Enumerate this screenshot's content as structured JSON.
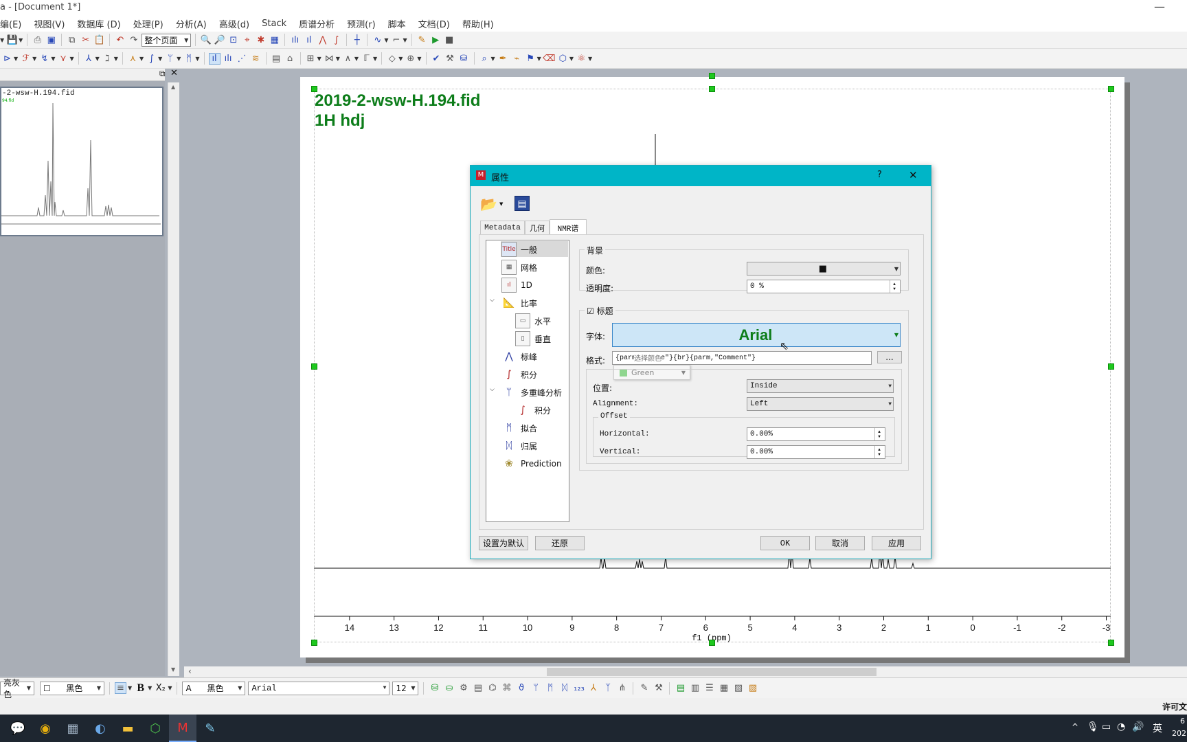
{
  "window": {
    "title": "a - [Document 1*]"
  },
  "menu": [
    "编(E)",
    "视图(V)",
    "数据库 (D)",
    "处理(P)",
    "分析(A)",
    "高级(d)",
    "Stack",
    "质谱分析",
    "预测(r)",
    "脚本",
    "文档(D)",
    "帮助(H)"
  ],
  "toolbar": {
    "page_select": "整个页面"
  },
  "left_panel": {
    "thumb_title": "-2-wsw-H.194.fid",
    "thumb_sub": "94.fid"
  },
  "document": {
    "title_line1": "2019-2-wsw-H.194.fid",
    "title_line2": "1H hdj",
    "axis_label": "f1 (ppm)"
  },
  "chart_data": {
    "type": "line",
    "xlabel": "f1 (ppm)",
    "xlim": [
      14.8,
      -3.1
    ],
    "x_reversed": true,
    "ticks": [
      14,
      13,
      12,
      11,
      10,
      9,
      8,
      7,
      6,
      5,
      4,
      3,
      2,
      1,
      0,
      -1,
      -2,
      -3
    ],
    "tick_labels": [
      "14",
      "13",
      "12",
      "11",
      "10",
      "9",
      "8",
      "7",
      "6",
      "5",
      "4",
      "3",
      "2",
      "1",
      "0",
      "-1",
      "-2",
      "-3"
    ]
  },
  "dialog": {
    "title": "属性",
    "help": "?",
    "close": "✕",
    "tabs": [
      "Metadata",
      "几何",
      "NMR谱"
    ],
    "tree": [
      {
        "label": "一般",
        "selected": true
      },
      {
        "label": "网格"
      },
      {
        "label": "1D"
      },
      {
        "label": "比率",
        "expanded": true
      },
      {
        "label": "水平"
      },
      {
        "label": "垂直"
      },
      {
        "label": "标峰"
      },
      {
        "label": "积分"
      },
      {
        "label": "多重峰分析",
        "expanded": true
      },
      {
        "label": "积分"
      },
      {
        "label": "拟合"
      },
      {
        "label": "归属"
      },
      {
        "label": "Prediction"
      }
    ],
    "background_group": "背景",
    "color_label": "颜色:",
    "color_value": "■",
    "opacity_label": "透明度:",
    "opacity_value": "0 %",
    "title_group": "标题",
    "title_checked": "☑",
    "font_label": "字体:",
    "font_value": "Arial",
    "format_label": "格式:",
    "format_value": "{parm,\"Title\"}{br}{parm,\"Comment\"}",
    "format_overlay": "选择颜色",
    "browse": "...",
    "color_popup": "Green",
    "position_label": "位置:",
    "position_value": "Inside",
    "alignment_label": "Alignment:",
    "alignment_value": "Left",
    "offset_group": "Offset",
    "horizontal_label": "Horizontal:",
    "horizontal_value": "0.00%",
    "vertical_label": "Vertical:",
    "vertical_value": "0.00%",
    "btn_default": "设置为默认",
    "btn_restore": "还原",
    "btn_ok": "OK",
    "btn_cancel": "取消",
    "btn_apply": "应用"
  },
  "bottom_toolbar": {
    "bg_color": "亮灰色",
    "border_color": "黑色",
    "bold": "B",
    "subscript": "X₂",
    "font_color_glyph": "A",
    "font_color": "黑色",
    "font": "Arial",
    "size": "12"
  },
  "status": {
    "license": "许可文"
  },
  "taskbar": {
    "ime": "英",
    "clock1": "6",
    "clock2": "202"
  },
  "colors": {
    "accent": "#00b5c7",
    "title_green": "#0d7d1a",
    "handle": "#1ec81e"
  }
}
